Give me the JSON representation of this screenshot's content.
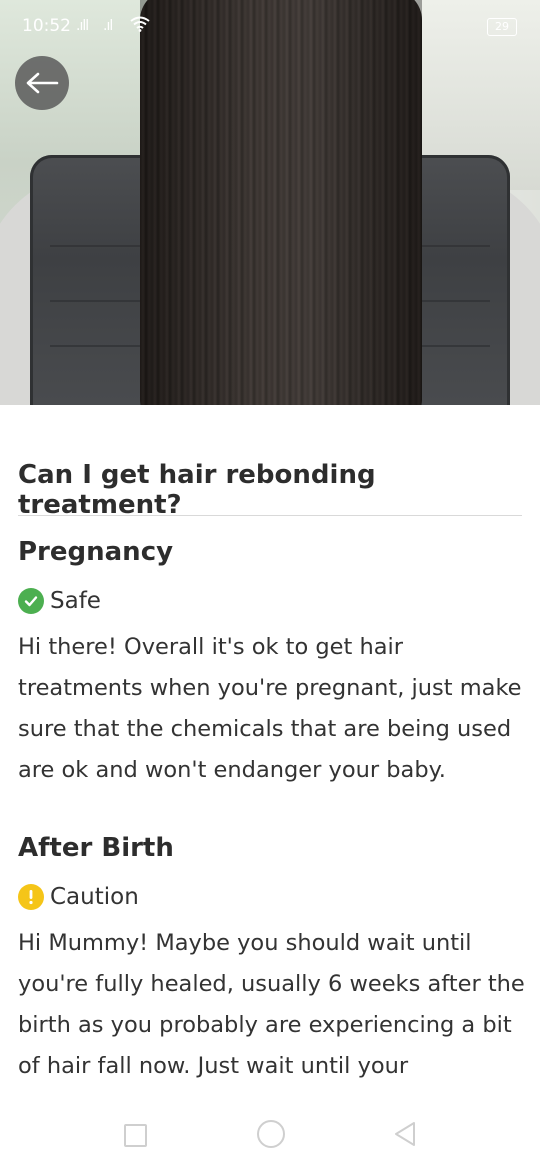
{
  "status_bar": {
    "time": "10:52",
    "signal_1": ".ıll",
    "signal_2": ".ıl",
    "battery": "29"
  },
  "hero": {
    "image_description_icon": "photo-hair-icon"
  },
  "header": {
    "back_icon": "arrow-left-icon"
  },
  "question": {
    "title": "Can I get hair rebonding treatment?"
  },
  "sections": [
    {
      "title": "Pregnancy",
      "status_label": "Safe",
      "status_icon": "check-circle-icon",
      "status_color": "#4caf50",
      "text": "Hi there! Overall it's ok to get hair treatments when you're pregnant, just make sure that the chemicals that are being used are ok and won't endanger your baby."
    },
    {
      "title": "After Birth",
      "status_label": "Caution",
      "status_icon": "exclamation-circle-icon",
      "status_color": "#f5c518",
      "text": "Hi Mummy! Maybe you should wait until you're fully healed, usually 6 weeks after the birth as you probably are experiencing a bit of hair fall now. Just wait until your"
    }
  ],
  "nav_bar": {
    "recents_icon": "square-icon",
    "home_icon": "circle-icon",
    "back_icon": "triangle-back-icon"
  }
}
